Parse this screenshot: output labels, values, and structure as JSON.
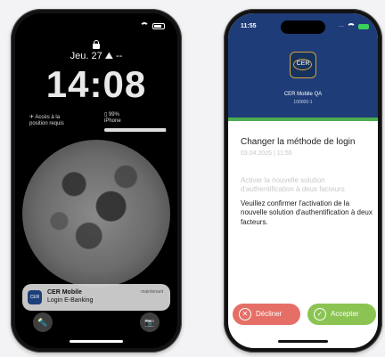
{
  "lock_screen": {
    "date": "Jeu. 27 ⛰ --",
    "time": "14:08",
    "access_widget": "✈ Accès à la\nposition requis",
    "battery_widget": {
      "percent_label": "99%",
      "device": "iPhone",
      "level": 0.99
    },
    "notification": {
      "app_icon_label": "CER",
      "title": "CER Mobile",
      "body": "Login E-Banking",
      "when": "maintenant"
    },
    "flashlight_glyph": "🔦",
    "camera_glyph": "📷"
  },
  "app_screen": {
    "status_time": "11:55",
    "logo_text": "CER",
    "app_name": "CER Mobile QA",
    "app_id": "100000-1",
    "progress": 1.0,
    "title": "Changer la méthode de login",
    "timestamp": "03.04.2025 | 11:55",
    "description_faint": "Activer la nouvelle solution d'authentification à deux facteurs",
    "description": "Veuillez confirmer l'activation de la nouvelle solution d'authentification à deux facteurs.",
    "decline_label": "Décliner",
    "decline_icon": "✕",
    "accept_label": "Accepter",
    "accept_icon": "✓"
  },
  "colors": {
    "header_blue": "#1e3c78",
    "decline_red": "#e56f66",
    "accept_green": "#8bc453",
    "progress_green": "#4cae4f"
  }
}
